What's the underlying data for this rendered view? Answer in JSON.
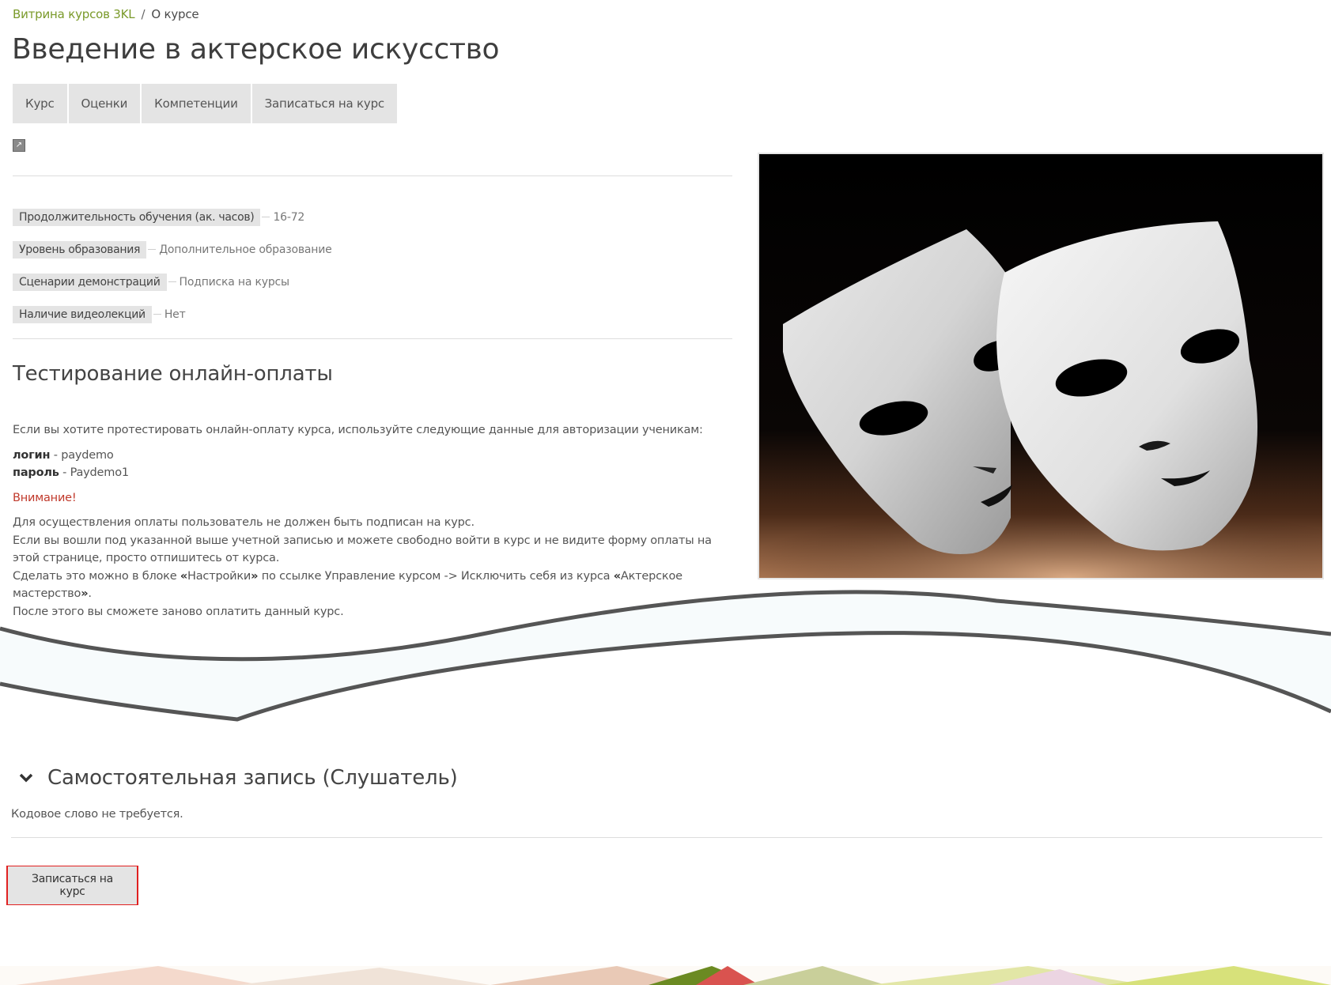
{
  "breadcrumb": {
    "home": "Витрина курсов 3KL",
    "separator": "/",
    "current": "О курсе"
  },
  "page": {
    "title": "Введение в актерское искусство"
  },
  "tabs": [
    {
      "label": "Курс"
    },
    {
      "label": "Оценки"
    },
    {
      "label": "Компетенции"
    },
    {
      "label": "Записаться на курс"
    }
  ],
  "properties": [
    {
      "label": "Продолжительность обучения (ак. часов)",
      "value": "16-72"
    },
    {
      "label": "Уровень образования",
      "value": "Дополнительное образование"
    },
    {
      "label": "Сценарии демонстраций",
      "value": "Подписка на курсы"
    },
    {
      "label": "Наличие видеолекций",
      "value": "Нет"
    }
  ],
  "section": {
    "title": "Тестирование онлайн-оплаты",
    "intro": "Если вы хотите протестировать онлайн-оплату курса, используйте следующие данные для авторизации ученикам:",
    "login_label": "логин",
    "login_value": " - paydemo",
    "password_label": "пароль",
    "password_value": " - Paydemo1",
    "warning": "Внимание!",
    "line1": "Для осуществления оплаты пользователь не должен быть подписан на курс.",
    "line2": "Если вы вошли под указанной выше учетной записью и можете свободно войти в курс и не видите форму оплаты на этой странице, просто отпишитесь от курса.",
    "line3_a": "Сделать это можно в блоке ",
    "line3_quote_open": "«",
    "line3_settings": "Настройки",
    "line3_quote_close": "»",
    "line3_b": " по ссылке Управление курсом -> Исключить себя из курса ",
    "line3_course": "Актерское мастерство",
    "line3_end": ".",
    "line4": "После этого вы сможете заново оплатить данный курс."
  },
  "enrol": {
    "heading": "Самостоятельная запись (Слушатель)",
    "note": "Кодовое слово не требуется.",
    "button": "Записаться на курс"
  },
  "icons": {
    "tiny": "image-link-icon",
    "chevron": "chevron-down-icon"
  },
  "colors": {
    "breadcrumb_link": "#7a9a2a",
    "warning": "#c0392b",
    "tab_bg": "#e4e4e4",
    "highlight_border": "#e02020"
  }
}
